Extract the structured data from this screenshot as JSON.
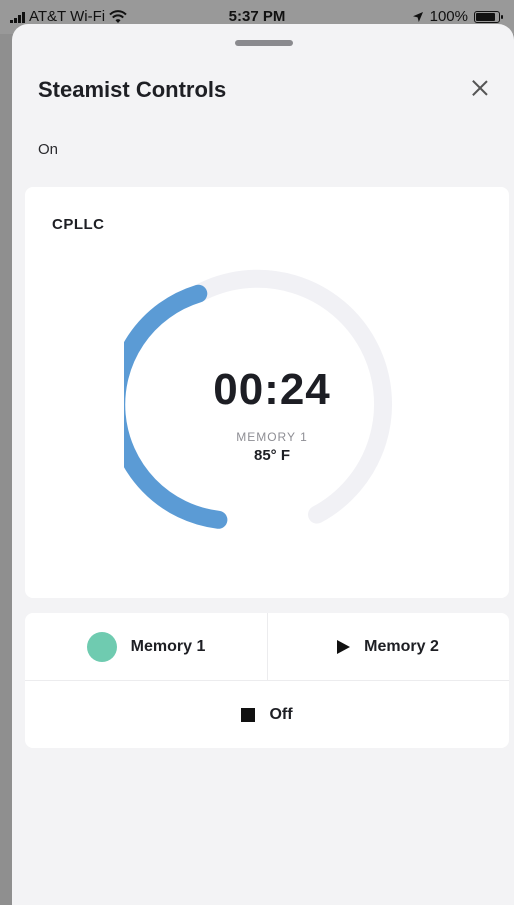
{
  "status_bar": {
    "carrier": "AT&T Wi-Fi",
    "time": "5:37 PM",
    "battery": "100%",
    "battery_level": 1.0
  },
  "sheet": {
    "title": "Steamist Controls",
    "status": "On"
  },
  "device": {
    "name": "CPLLC",
    "timer": "00:24",
    "memory_label": "MEMORY 1",
    "temperature": "85° F",
    "progress_color": "#5b9bd5",
    "track_color": "#f1f1f5"
  },
  "controls": {
    "memory1_label": "Memory 1",
    "memory1_color": "#6fcbb0",
    "memory2_label": "Memory 2",
    "off_label": "Off"
  },
  "icons": {
    "close": "close-icon",
    "play": "play-icon",
    "stop": "stop-icon",
    "active": "active-dot-icon"
  }
}
